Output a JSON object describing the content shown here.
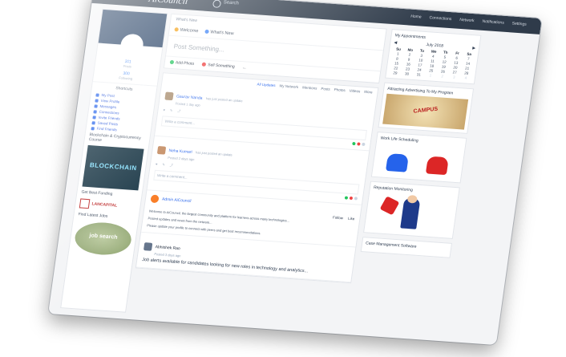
{
  "header": {
    "brand": "AiCouncil",
    "search_placeholder": "Search",
    "nav": [
      "Home",
      "Connections",
      "Network",
      "Notifications",
      "Settings"
    ]
  },
  "left": {
    "stats": [
      {
        "value": "311",
        "label": "Posts"
      },
      {
        "value": "300",
        "label": "Following"
      }
    ],
    "section": "Shortcuts",
    "menu": [
      "My Post",
      "View Profile",
      "Messages",
      "Connections",
      "Invite Friends",
      "Saved Posts",
      "Find Friends"
    ],
    "blockchain_heading": "Blockchain & Cryptocurrency Course",
    "blockchain_label": "BLOCKCHAIN",
    "partner_heading": "Get Best Funding",
    "partner_label": "LANCAPITAL",
    "job_heading": "Find Latest Jobs",
    "job_label": "job search"
  },
  "center": {
    "whats_new": "What's New",
    "tabs": [
      "Welcome",
      "What's New"
    ],
    "composer_placeholder": "Post Something...",
    "composer_actions": [
      "Add Photo",
      "Sell Something",
      "..."
    ],
    "feed_tabs": [
      "All Updates",
      "My Network",
      "Mentions",
      "Posts",
      "Photos",
      "Videos",
      "More"
    ],
    "posts": [
      {
        "name": "Gaurav Nanda",
        "action": "has just posted an update",
        "meta": "Posted 1 day ago",
        "comment_placeholder": "Write a comment..."
      },
      {
        "name": "Neha Kumari",
        "action": "has just posted an update",
        "meta": "Posted 2 days ago",
        "comment_placeholder": "Write a comment..."
      }
    ],
    "article": {
      "author": "Admin AiCouncil",
      "follow_labels": [
        "Follow",
        "Like"
      ],
      "paragraphs": [
        "Welcome to AiCouncil, the largest community and platform for learners across many technologies...",
        "Posted updates and news from the network...",
        "Please update your profile to connect with peers and get best recommendations."
      ]
    },
    "last_post": {
      "name": "Abhishek Rao",
      "meta": "Posted 3 days ago",
      "text": "Job alerts available for candidates looking for new roles in technology and analytics..."
    }
  },
  "right": {
    "appointments_title": "My Appointments",
    "calendar": {
      "month": "July 2018",
      "days_of_week": [
        "Su",
        "Mo",
        "Tu",
        "We",
        "Th",
        "Fr",
        "Sa"
      ],
      "cells": [
        "1",
        "2",
        "3",
        "4",
        "5",
        "6",
        "7",
        "8",
        "9",
        "10",
        "11",
        "12",
        "13",
        "14",
        "15",
        "16",
        "17",
        "18",
        "19",
        "20",
        "21",
        "22",
        "23",
        "24",
        "25",
        "26",
        "27",
        "28",
        "29",
        "30",
        "31",
        "1",
        "2",
        "3",
        "4"
      ]
    },
    "ads": [
      {
        "title": "Attracting Advertising To My Program",
        "label": "CAMPUS"
      },
      {
        "title": "Work Life Scheduling",
        "label": ""
      },
      {
        "title": "Reputation Monitoring",
        "label": ""
      },
      {
        "title": "Case Management Software",
        "label": ""
      }
    ]
  },
  "colors": {
    "topbar": "#2f3b4a",
    "accent": "#2563eb",
    "cover": "#1e3a5f"
  }
}
